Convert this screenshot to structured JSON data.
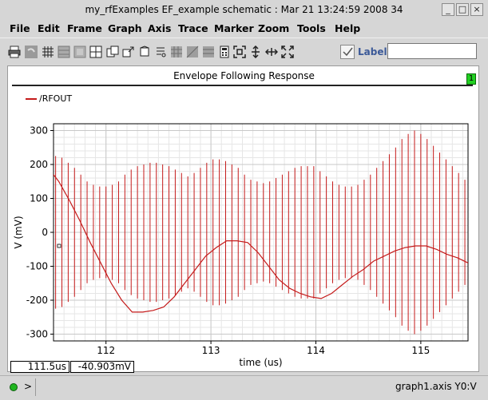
{
  "window": {
    "title": "my_rfExamples EF_example schematic : Mar 21 13:24:59 2008 34",
    "buttons": {
      "minimize": "_",
      "maximize": "□",
      "close": "×"
    }
  },
  "menu": [
    "File",
    "Edit",
    "Frame",
    "Graph",
    "Axis",
    "Trace",
    "Marker",
    "Zoom",
    "Tools",
    "Help"
  ],
  "toolbar": {
    "icons": [
      "print-icon",
      "undo-icon",
      "grid-icon",
      "table-icon",
      "frame-icon",
      "layout-icon",
      "copy-icon",
      "export-icon",
      "legend-icon",
      "hash-icon",
      "hash-alt-icon",
      "grid-alt-icon",
      "calculator-icon",
      "crosshair-icon",
      "zoom-vertical-icon",
      "zoom-horizontal-icon",
      "fit-icon"
    ],
    "label_text": "Label",
    "label_input": ""
  },
  "graph": {
    "title": "Envelope Following Response",
    "badge": "1",
    "legend": "/RFOUT",
    "trace_color": "#c41a1a"
  },
  "chart_data": {
    "type": "line",
    "title": "Envelope Following Response",
    "xlabel": "time (us)",
    "ylabel": "V (mV)",
    "xlim": [
      111.5,
      115.45
    ],
    "ylim": [
      -320,
      320
    ],
    "xticks": [
      "112",
      "113",
      "114",
      "115"
    ],
    "xtick_values": [
      112,
      113,
      114,
      115
    ],
    "yticks": [
      "-300",
      "-200",
      "-100",
      "0",
      "100",
      "200",
      "300"
    ],
    "ytick_values": [
      -300,
      -200,
      -100,
      0,
      100,
      200,
      300
    ],
    "grid": true,
    "legend_position": "top-left",
    "series": [
      {
        "name": "/RFOUT",
        "envelope": {
          "x": [
            111.5,
            111.55,
            111.65,
            111.75,
            111.85,
            111.95,
            112.05,
            112.15,
            112.25,
            112.35,
            112.45,
            112.55,
            112.65,
            112.75,
            112.85,
            112.95,
            113.05,
            113.15,
            113.25,
            113.35,
            113.45,
            113.55,
            113.65,
            113.75,
            113.85,
            113.95,
            114.05,
            114.15,
            114.25,
            114.35,
            114.45,
            114.55,
            114.65,
            114.75,
            114.85,
            114.95,
            115.05,
            115.15,
            115.25,
            115.35,
            115.45
          ],
          "y": [
            170,
            150,
            95,
            35,
            -30,
            -90,
            -150,
            -200,
            -235,
            -235,
            -230,
            -220,
            -190,
            -150,
            -110,
            -70,
            -45,
            -25,
            -25,
            -30,
            -60,
            -100,
            -140,
            -165,
            -180,
            -190,
            -195,
            -180,
            -155,
            -130,
            -110,
            -85,
            -70,
            -55,
            -45,
            -40,
            -40,
            -50,
            -65,
            -75,
            -90
          ]
        },
        "rf_peak": {
          "x": [
            111.52,
            111.58,
            111.64,
            111.7,
            111.76,
            111.82,
            111.88,
            111.94,
            112.0,
            112.06,
            112.12,
            112.18,
            112.24,
            112.3,
            112.36,
            112.42,
            112.48,
            112.54,
            112.6,
            112.66,
            112.72,
            112.78,
            112.84,
            112.9,
            112.96,
            113.02,
            113.08,
            113.14,
            113.2,
            113.26,
            113.32,
            113.38,
            113.44,
            113.5,
            113.56,
            113.62,
            113.68,
            113.74,
            113.8,
            113.86,
            113.92,
            113.98,
            114.04,
            114.1,
            114.16,
            114.22,
            114.28,
            114.34,
            114.4,
            114.46,
            114.52,
            114.58,
            114.64,
            114.7,
            114.76,
            114.82,
            114.88,
            114.94,
            115.0,
            115.06,
            115.12,
            115.18,
            115.24,
            115.3,
            115.36,
            115.42
          ],
          "y_top": [
            225,
            220,
            205,
            190,
            170,
            150,
            140,
            135,
            135,
            140,
            150,
            170,
            185,
            195,
            200,
            205,
            205,
            200,
            195,
            185,
            175,
            165,
            175,
            190,
            205,
            215,
            215,
            210,
            200,
            190,
            170,
            155,
            150,
            145,
            150,
            160,
            170,
            180,
            190,
            195,
            195,
            195,
            180,
            165,
            150,
            140,
            135,
            135,
            140,
            155,
            170,
            190,
            210,
            230,
            250,
            275,
            290,
            300,
            290,
            275,
            255,
            235,
            215,
            195,
            175,
            155
          ],
          "y_bottom": [
            -225,
            -220,
            -205,
            -190,
            -170,
            -150,
            -140,
            -135,
            -135,
            -140,
            -150,
            -170,
            -185,
            -195,
            -200,
            -205,
            -205,
            -200,
            -195,
            -185,
            -175,
            -165,
            -175,
            -190,
            -205,
            -215,
            -215,
            -210,
            -200,
            -190,
            -170,
            -155,
            -150,
            -145,
            -150,
            -160,
            -170,
            -180,
            -190,
            -195,
            -195,
            -195,
            -180,
            -165,
            -150,
            -140,
            -135,
            -135,
            -140,
            -155,
            -170,
            -190,
            -210,
            -230,
            -250,
            -275,
            -290,
            -300,
            -290,
            -275,
            -255,
            -235,
            -215,
            -195,
            -175,
            -155
          ]
        }
      }
    ]
  },
  "readout": {
    "x": "111.5us",
    "y": "-40.903mV"
  },
  "status": {
    "prompt": ">",
    "axis_info": "graph1.axis Y0:V"
  }
}
